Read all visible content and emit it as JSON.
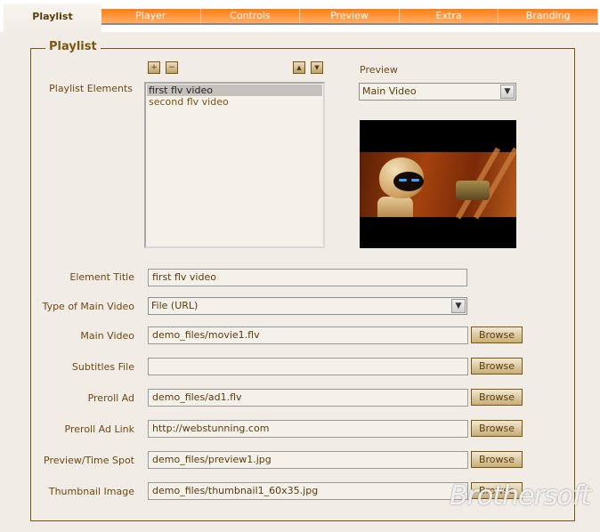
{
  "tabs": {
    "active": "Playlist",
    "others": [
      "Player",
      "Controls",
      "Preview",
      "Extra",
      "Branding"
    ]
  },
  "section": {
    "legend": "Playlist"
  },
  "playlist": {
    "label": "Playlist Elements",
    "add_icon": "+",
    "remove_icon": "−",
    "up_icon": "▲",
    "down_icon": "▼",
    "items": [
      {
        "label": "first flv video",
        "selected": true
      },
      {
        "label": "second flv video",
        "selected": false
      }
    ]
  },
  "preview": {
    "label": "Preview",
    "selected": "Main Video",
    "image_description": "video frame showing robot characters"
  },
  "form": {
    "element_title": {
      "label": "Element Title",
      "value": "first flv video"
    },
    "type_main_video": {
      "label": "Type of Main Video",
      "value": "File (URL)"
    },
    "fields": [
      {
        "label": "Main Video",
        "value": "demo_files/movie1.flv",
        "button": "Browse"
      },
      {
        "label": "Subtitles File",
        "value": "",
        "button": "Browse"
      },
      {
        "label": "Preroll Ad",
        "value": "demo_files/ad1.flv",
        "button": "Browse"
      },
      {
        "label": "Preroll Ad Link",
        "value": "http://webstunning.com",
        "button": "Browse"
      },
      {
        "label": "Preview/Time Spot",
        "value": "demo_files/preview1.jpg",
        "button": "Browse"
      },
      {
        "label": "Thumbnail Image",
        "value": "demo_files/thumbnail1_60x35.jpg",
        "button": "Browse"
      }
    ]
  },
  "watermark": "Brothersoft",
  "colors": {
    "accent_orange": "#ff7f14",
    "brown": "#7a5610",
    "background": "#f2ece6"
  }
}
